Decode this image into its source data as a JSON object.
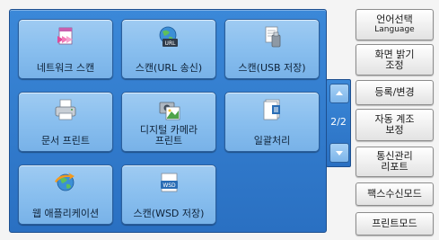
{
  "tiles": [
    {
      "label": "네트워크 스캔",
      "icon": "network-scan-icon"
    },
    {
      "label": "스캔(URL 송신)",
      "icon": "scan-url-icon"
    },
    {
      "label": "스캔(USB 저장)",
      "icon": "scan-usb-icon"
    },
    {
      "label": "문서 프린트",
      "icon": "printer-icon"
    },
    {
      "label": "디지털 카메라\n프린트",
      "icon": "camera-print-icon"
    },
    {
      "label": "일괄처리",
      "icon": "batch-process-icon"
    },
    {
      "label": "웹 애플리케이션",
      "icon": "web-application-icon"
    },
    {
      "label": "스캔(WSD 저장)",
      "icon": "scan-wsd-icon"
    }
  ],
  "wsd_icon_text": "WSD",
  "url_icon_text": "URL",
  "pager": {
    "indicator": "2/2"
  },
  "side": {
    "language_line1": "언어선택",
    "language_line2": "Language",
    "brightness_line1": "화면 밝기",
    "brightness_line2": "조정",
    "register": "등록/변경",
    "auto_line1": "자동 계조",
    "auto_line2": "보정",
    "report_line1": "통신관리",
    "report_line2": "리포트",
    "fax_mode": "팩스수신모드",
    "print_mode": "프린트모드"
  },
  "colors": {
    "panel": "#2a70c2",
    "tile": "#8bc0ef",
    "side": "#e2e2e2"
  }
}
